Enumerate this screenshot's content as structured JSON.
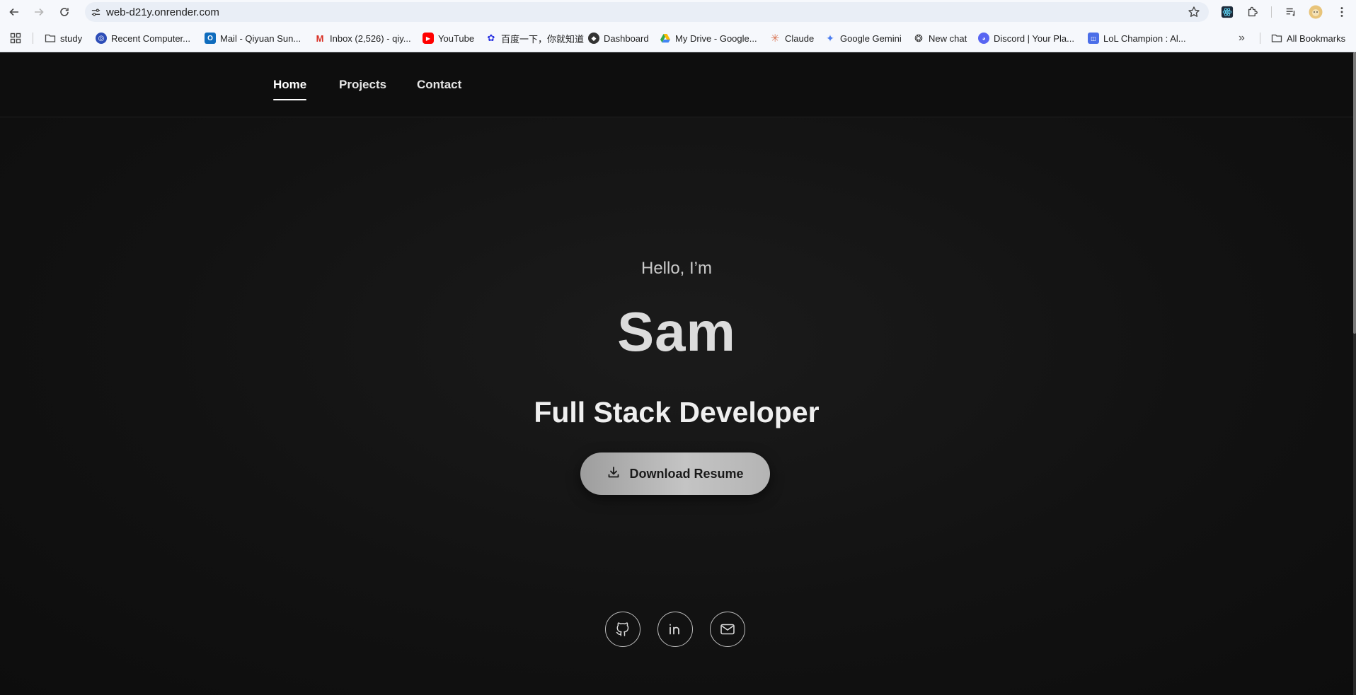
{
  "browser": {
    "url": "web-d21y.onrender.com",
    "bookmarks": [
      {
        "label": "study",
        "icon": "folder-icon"
      },
      {
        "label": "Recent Computer...",
        "icon": "ring-icon"
      },
      {
        "label": "Mail - Qiyuan Sun...",
        "icon": "outlook-icon"
      },
      {
        "label": "Inbox (2,526) - qiy...",
        "icon": "gmail-icon"
      },
      {
        "label": "YouTube",
        "icon": "youtube-icon"
      },
      {
        "label": "百度一下，你就知道",
        "icon": "baidu-icon"
      },
      {
        "label": "Dashboard",
        "icon": "shield-icon"
      },
      {
        "label": "My Drive - Google...",
        "icon": "drive-icon"
      },
      {
        "label": "Claude",
        "icon": "claude-icon"
      },
      {
        "label": "Google Gemini",
        "icon": "gemini-icon"
      },
      {
        "label": "New chat",
        "icon": "openai-icon"
      },
      {
        "label": "Discord | Your Pla...",
        "icon": "discord-icon"
      },
      {
        "label": "LoL Champion : Al...",
        "icon": "lol-icon"
      }
    ],
    "all_bookmarks": "All Bookmarks"
  },
  "nav": {
    "items": [
      {
        "label": "Home",
        "active": true
      },
      {
        "label": "Projects",
        "active": false
      },
      {
        "label": "Contact",
        "active": false
      }
    ]
  },
  "hero": {
    "greeting": "Hello, I’m",
    "name": "Sam",
    "role": "Full Stack Developer",
    "resume_button": "Download Resume"
  },
  "social": [
    {
      "name": "github-icon"
    },
    {
      "name": "linkedin-icon"
    },
    {
      "name": "email-icon"
    }
  ],
  "colors": {
    "page_bg": "#121212",
    "button_bg": "#b4b4b4",
    "text_primary": "#efefef"
  }
}
